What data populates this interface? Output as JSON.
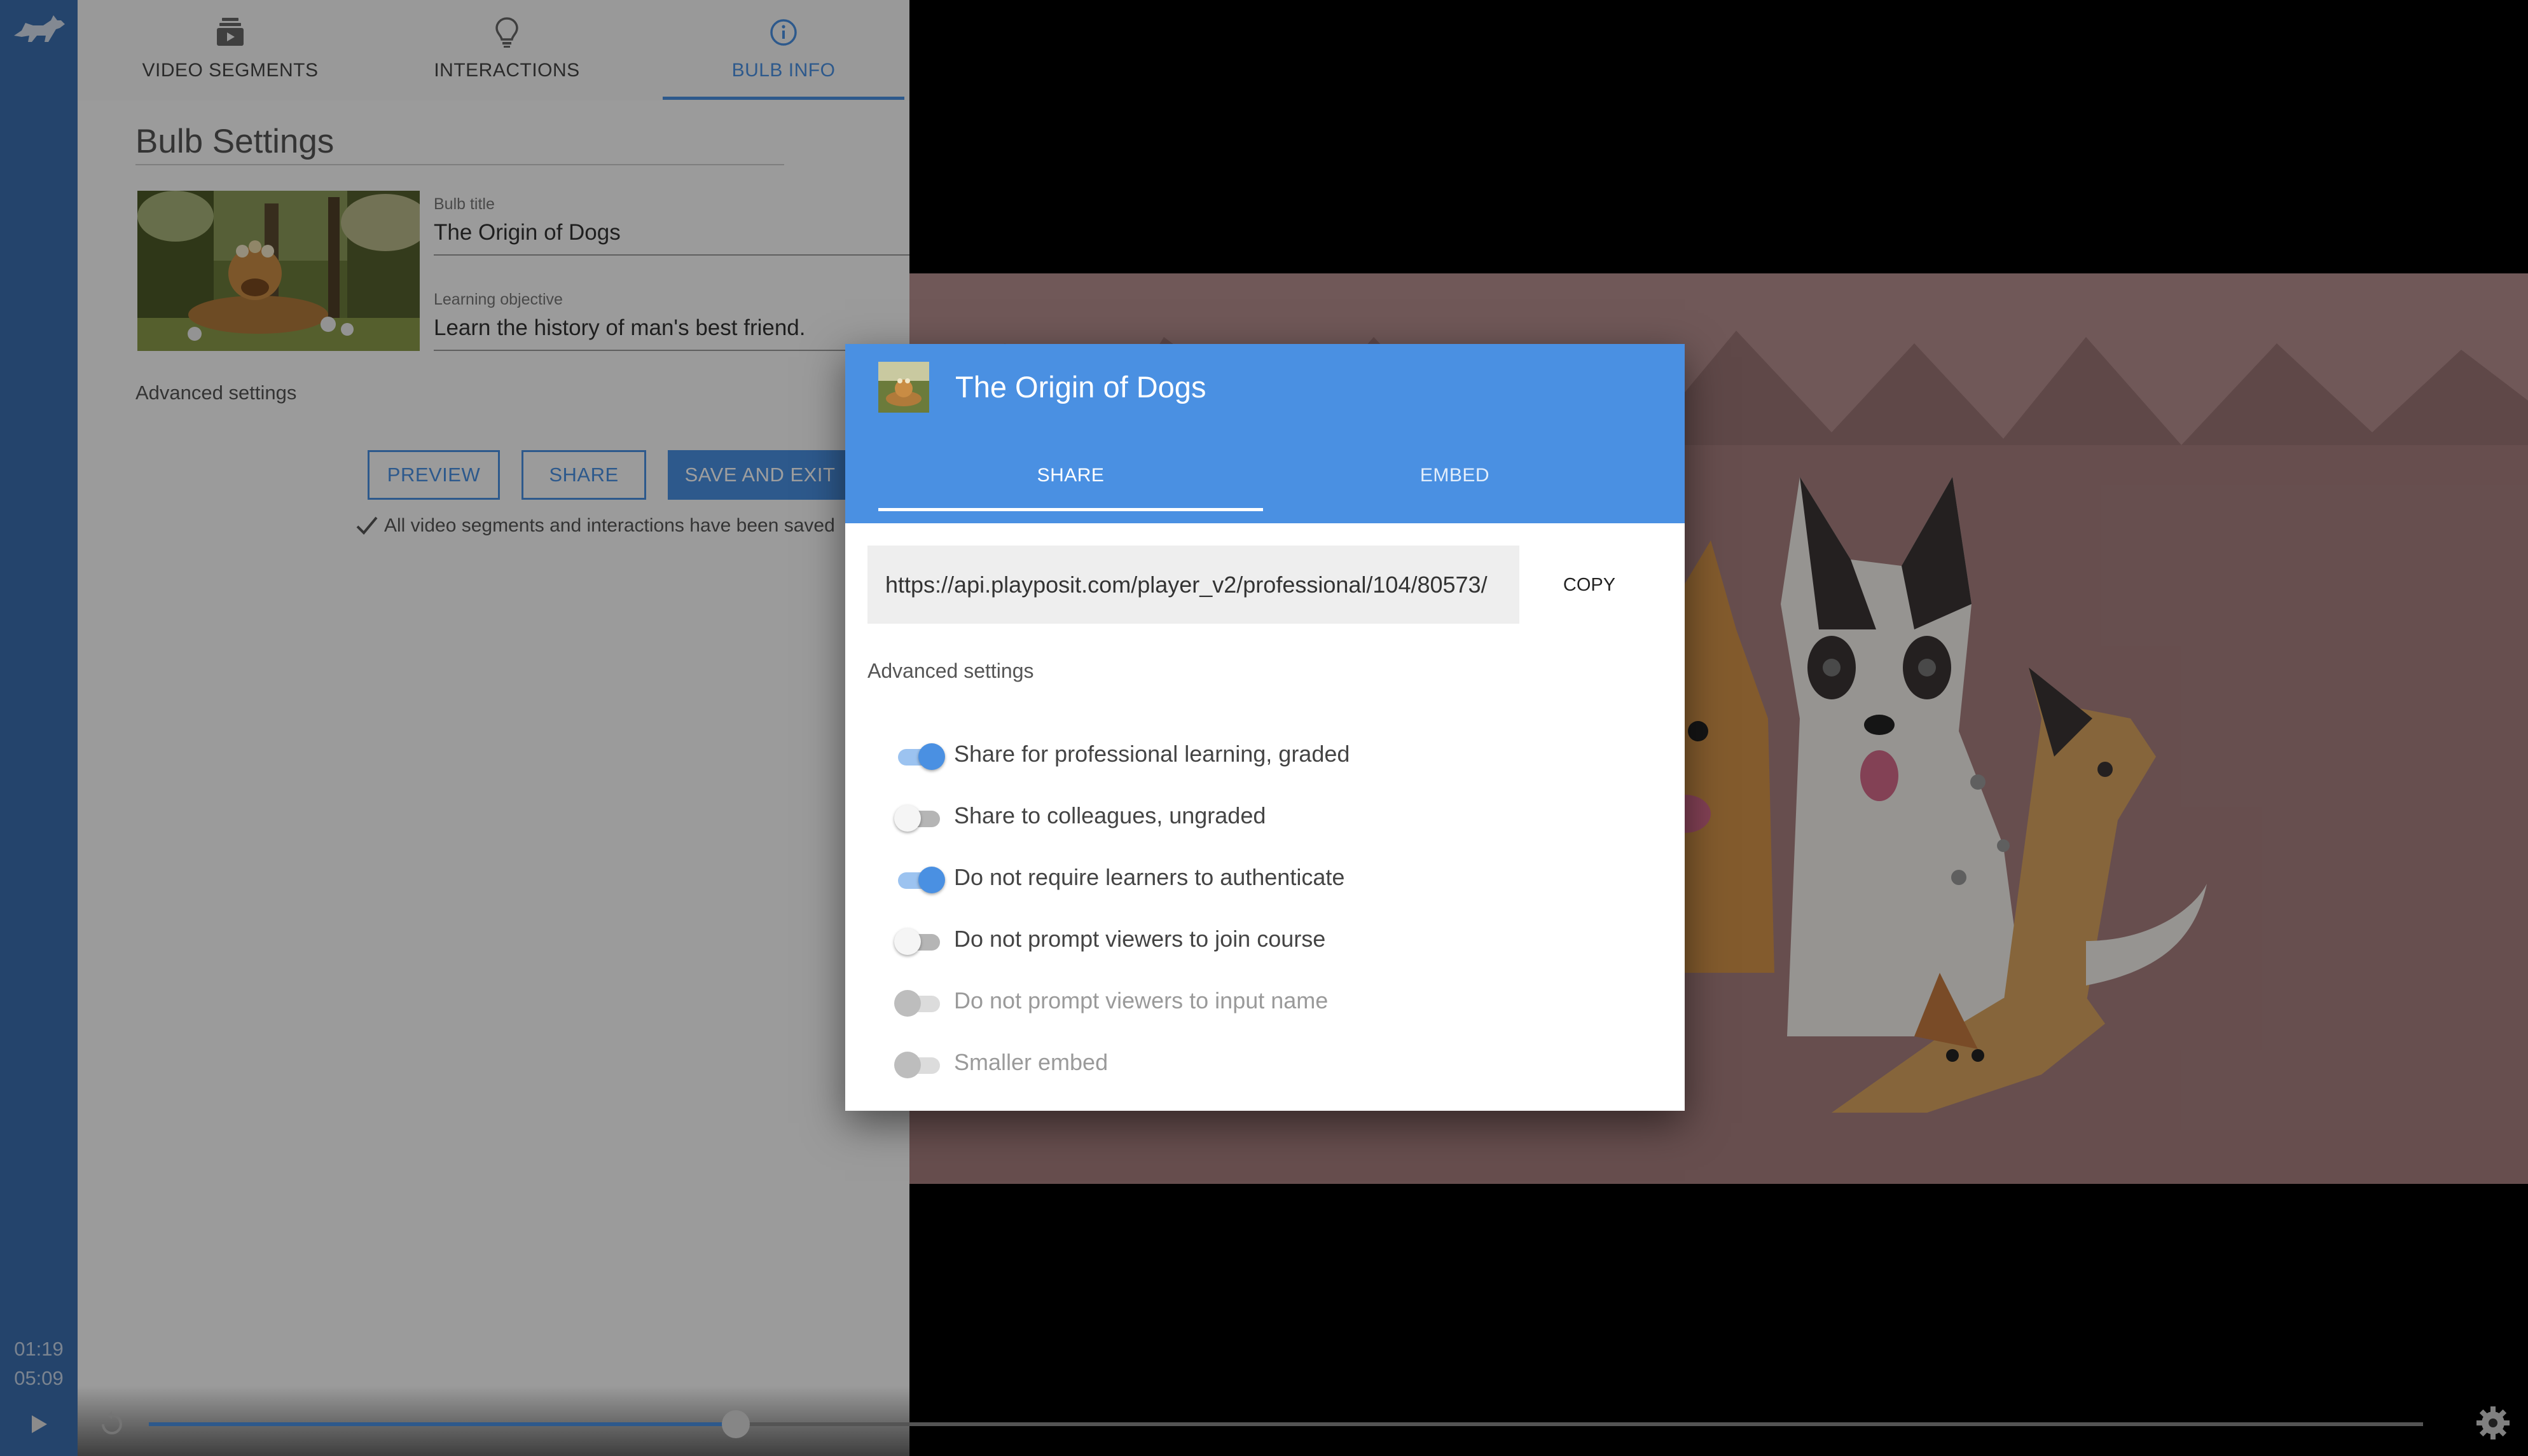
{
  "sidebar": {
    "time_current": "01:19",
    "time_total": "05:09"
  },
  "editor": {
    "tabs": [
      {
        "label": "VIDEO SEGMENTS",
        "icon": "video-segments-icon"
      },
      {
        "label": "INTERACTIONS",
        "icon": "lightbulb-icon"
      },
      {
        "label": "BULB INFO",
        "icon": "info-icon"
      }
    ],
    "active_tab": "BULB INFO",
    "heading": "Bulb Settings",
    "bulb_title_label": "Bulb title",
    "bulb_title_value": "The Origin of Dogs",
    "objective_label": "Learning objective",
    "objective_value": "Learn the history of man's best friend.",
    "advanced_settings": "Advanced settings",
    "buttons": {
      "preview": "PREVIEW",
      "share": "SHARE",
      "save_exit": "SAVE AND EXIT"
    },
    "saved_message": "All video segments and interactions have been saved"
  },
  "modal": {
    "title": "The Origin of Dogs",
    "tabs": {
      "share": "SHARE",
      "embed": "EMBED"
    },
    "active_tab": "SHARE",
    "url": "https://api.playposit.com/player_v2/professional/104/80573/",
    "copy_label": "COPY",
    "advanced_settings": "Advanced settings",
    "options": [
      {
        "label": "Share for professional learning, graded",
        "state": "on"
      },
      {
        "label": "Share to colleagues, ungraded",
        "state": "off"
      },
      {
        "label": "Do not require learners to authenticate",
        "state": "on"
      },
      {
        "label": "Do not prompt viewers to join course",
        "state": "off"
      },
      {
        "label": "Do not prompt viewers to input name",
        "state": "disabled"
      },
      {
        "label": "Smaller embed",
        "state": "disabled"
      }
    ]
  },
  "player": {
    "progress_fraction": 0.258
  },
  "colors": {
    "accent": "#4a90e2",
    "rail": "#3a6fae",
    "scene_background": "#b58f8f"
  }
}
